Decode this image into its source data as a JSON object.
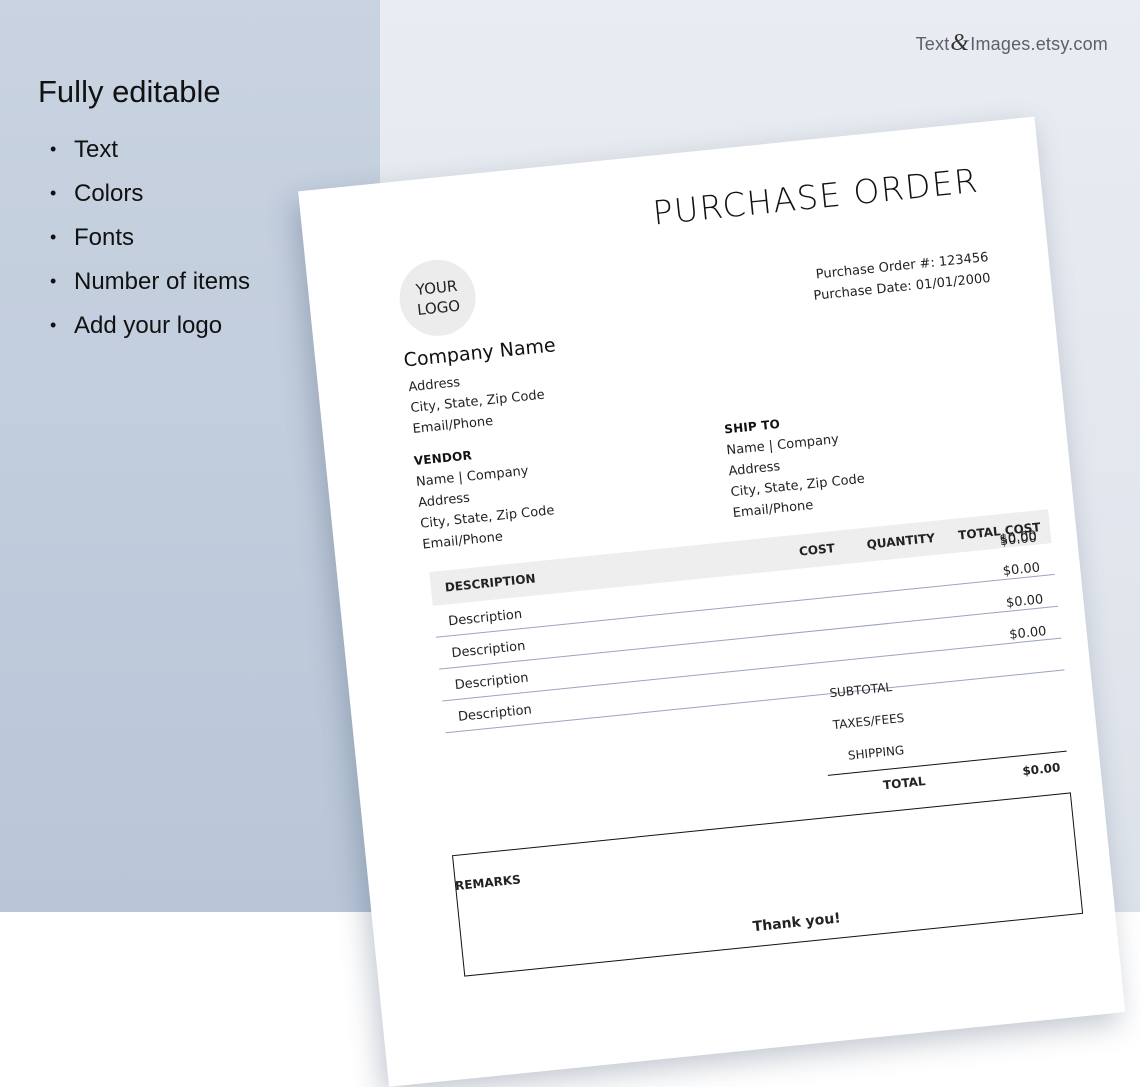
{
  "brand": {
    "part1": "Text",
    "amp": "&",
    "part2": "Images.etsy.com"
  },
  "promo": {
    "heading": "Fully editable",
    "features": [
      "Text",
      "Colors",
      "Fonts",
      "Number of items",
      "Add your logo"
    ]
  },
  "document": {
    "title": "PURCHASE ORDER",
    "logo": {
      "line1": "YOUR",
      "line2": "LOGO"
    },
    "company": {
      "name": "Company Name",
      "lines": [
        "Address",
        "City, State, Zip Code",
        "Email/Phone"
      ]
    },
    "po_number": "Purchase Order #: 123456",
    "po_date": "Purchase Date: 01/01/2000",
    "vendor": {
      "label": "VENDOR",
      "lines": [
        "Name | Company",
        "Address",
        "City, State, Zip Code",
        "Email/Phone"
      ]
    },
    "ship_to": {
      "label": "SHIP TO",
      "lines": [
        "Name | Company",
        "Address",
        "City, State, Zip Code",
        "Email/Phone"
      ]
    },
    "table": {
      "headers": {
        "description": "DESCRIPTION",
        "cost": "COST",
        "quantity": "QUANTITY",
        "total_cost": "TOTAL COST"
      },
      "rows": [
        {
          "description": "Description",
          "total": "$0.00"
        },
        {
          "description": "Description",
          "total": "$0.00"
        },
        {
          "description": "Description",
          "total": "$0.00"
        },
        {
          "description": "Description",
          "total": "$0.00"
        }
      ],
      "first_total": "$0.00"
    },
    "totals": {
      "subtotal_label": "SUBTOTAL",
      "taxes_label": "TAXES/FEES",
      "shipping_label": "SHIPPING",
      "total_label": "TOTAL",
      "total_value": "$0.00"
    },
    "remarks_label": "REMARKS",
    "thanks": "Thank you!"
  }
}
